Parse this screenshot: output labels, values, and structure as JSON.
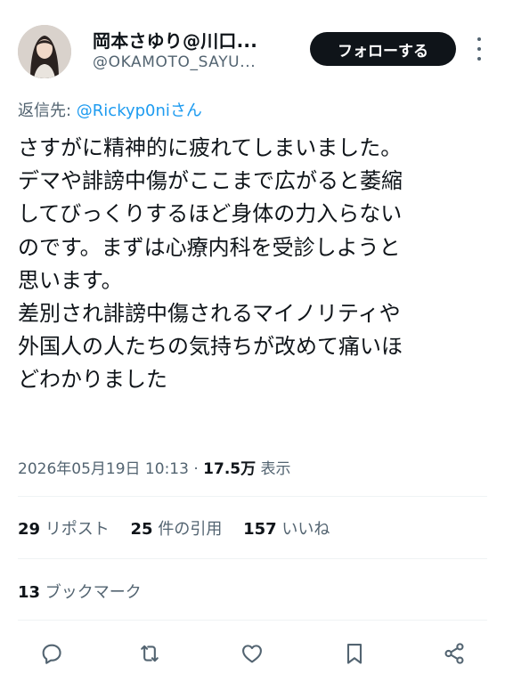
{
  "user": {
    "display_name": "岡本さゆり@川口...",
    "handle": "@OKAMOTO_SAYU...",
    "follow_label": "フォローする"
  },
  "reply": {
    "prefix": "返信先: ",
    "mention": "@Rickyp0ni",
    "suffix": "さん"
  },
  "tweet": {
    "lines": [
      "さすがに精神的に疲れてしまいました。",
      "デマや誹謗中傷がここまで広がると萎縮",
      "してびっくりするほど身体の力入らない",
      "のです。まずは心療内科を受診しようと",
      "思います。",
      "差別され誹謗中傷されるマイノリティや",
      "外国人の人たちの気持ちが改めて痛いほ",
      "どわかりました"
    ]
  },
  "meta": {
    "timestamp": "2026年05月19日 10:13",
    "separator": " · ",
    "views_count": "17.5万",
    "views_label": " 表示"
  },
  "stats": {
    "reposts_count": "29",
    "reposts_label": "リポスト",
    "quotes_count": "25",
    "quotes_label": "件の引用",
    "likes_count": "157",
    "likes_label": "いいね",
    "bookmarks_count": "13",
    "bookmarks_label": "ブックマーク"
  },
  "actions": [
    "reply-icon",
    "repost-icon",
    "like-icon",
    "bookmark-icon",
    "share-icon"
  ],
  "colors": {
    "text": "#0f1419",
    "secondary": "#536471",
    "accent": "#1d9bf0",
    "button_bg": "#0f1419",
    "divider": "#eff3f4"
  }
}
